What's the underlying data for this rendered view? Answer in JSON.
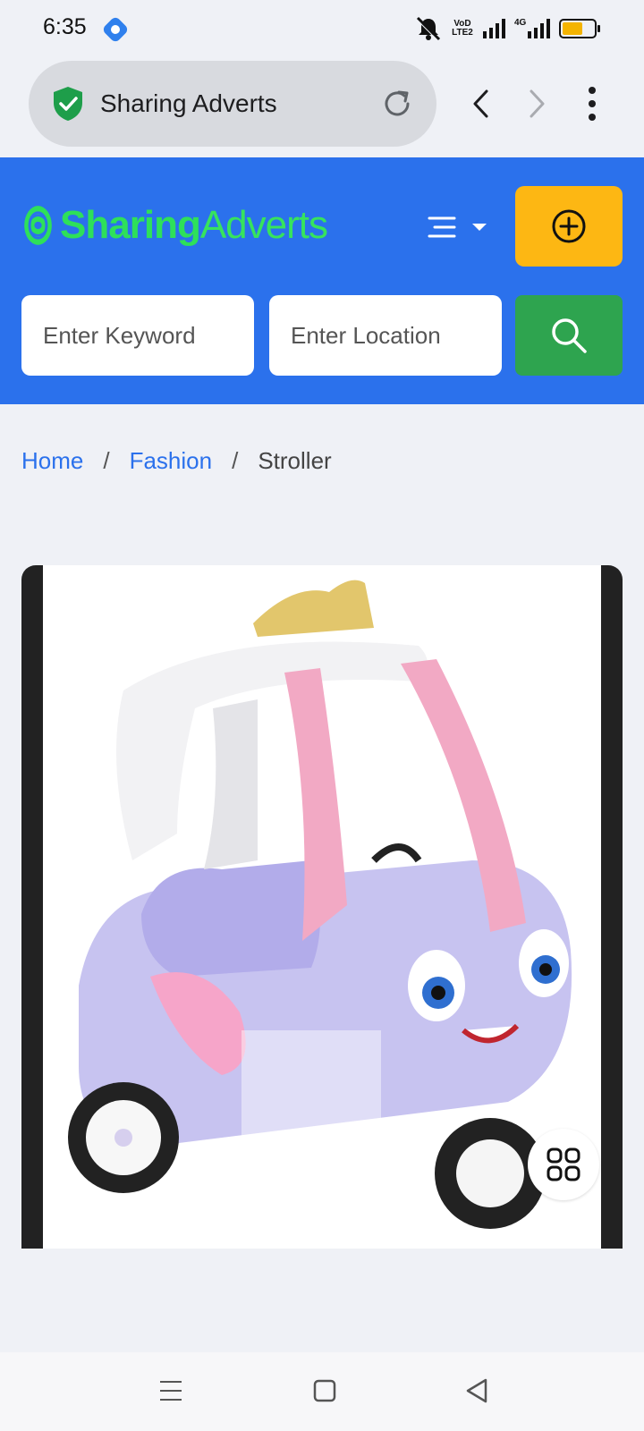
{
  "status_bar": {
    "time": "6:35",
    "network_label_1": "VoD LTE2",
    "network_label_2": "4G",
    "icons": [
      "app-icon",
      "mute-icon",
      "signal-icon",
      "battery-icon"
    ]
  },
  "browser": {
    "site_title": "Sharing Adverts",
    "icons": [
      "shield-check-icon",
      "reload-icon",
      "back-icon",
      "forward-icon",
      "menu-dots-icon"
    ]
  },
  "header": {
    "logo_part1": "Sharing",
    "logo_part2": "Adverts",
    "keyword_placeholder": "Enter Keyword",
    "location_placeholder": "Enter Location",
    "colors": {
      "header_bg": "#2b71ec",
      "post_button": "#fdb713",
      "search_button": "#2ea44f",
      "logo_green": "#2ee05a"
    }
  },
  "breadcrumb": {
    "home": "Home",
    "category": "Fashion",
    "current": "Stroller",
    "separator": "/"
  },
  "product": {
    "image_icon": "toy-car-image",
    "gallery_icon": "grid-icon"
  },
  "nav_bar": {
    "icons": [
      "menu-icon",
      "home-square-icon",
      "back-triangle-icon"
    ]
  }
}
